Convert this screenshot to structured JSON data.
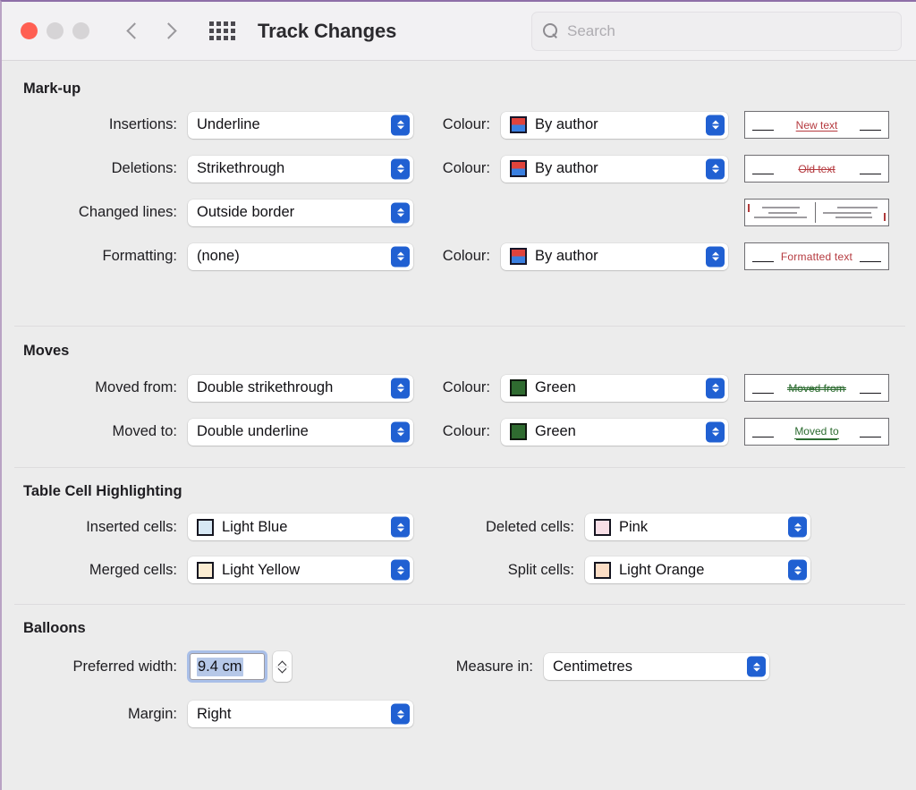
{
  "window": {
    "title": "Track Changes",
    "traffic_lights": [
      "close",
      "minimize",
      "zoom"
    ],
    "back_label": "Back",
    "forward_label": "Forward",
    "grid_label": "Show All"
  },
  "search": {
    "placeholder": "Search",
    "value": ""
  },
  "sections": {
    "markup": {
      "title": "Mark-up",
      "rows": [
        {
          "label": "Insertions:",
          "value": "Underline",
          "colour_label": "Colour:",
          "colour_value": "By author",
          "colour_swatch": "by-author",
          "preview_text": "New text",
          "preview_style": "insertion"
        },
        {
          "label": "Deletions:",
          "value": "Strikethrough",
          "colour_label": "Colour:",
          "colour_value": "By author",
          "colour_swatch": "by-author",
          "preview_text": "Old text",
          "preview_style": "deletion"
        },
        {
          "label": "Changed lines:",
          "value": "Outside border",
          "colour_label": "",
          "colour_value": "",
          "colour_swatch": "",
          "preview_text": "",
          "preview_style": "changed-lines"
        },
        {
          "label": "Formatting:",
          "value": "(none)",
          "colour_label": "Colour:",
          "colour_value": "By author",
          "colour_swatch": "by-author",
          "preview_text": "Formatted text",
          "preview_style": "formatting"
        }
      ]
    },
    "moves": {
      "title": "Moves",
      "rows": [
        {
          "label": "Moved from:",
          "value": "Double strikethrough",
          "colour_label": "Colour:",
          "colour_value": "Green",
          "colour_swatch": "green",
          "preview_text": "Moved from",
          "preview_style": "moved-from"
        },
        {
          "label": "Moved to:",
          "value": "Double underline",
          "colour_label": "Colour:",
          "colour_value": "Green",
          "colour_swatch": "green",
          "preview_text": "Moved to",
          "preview_style": "moved-to"
        }
      ]
    },
    "table_cells": {
      "title": "Table Cell Highlighting",
      "rows": [
        {
          "left_label": "Inserted cells:",
          "left_value": "Light Blue",
          "left_swatch": "light-blue",
          "right_label": "Deleted cells:",
          "right_value": "Pink",
          "right_swatch": "pink"
        },
        {
          "left_label": "Merged cells:",
          "left_value": "Light Yellow",
          "left_swatch": "light-yellow",
          "right_label": "Split cells:",
          "right_value": "Light Orange",
          "right_swatch": "light-orange"
        }
      ]
    },
    "balloons": {
      "title": "Balloons",
      "preferred_width_label": "Preferred width:",
      "preferred_width_value": "9.4 cm",
      "measure_in_label": "Measure in:",
      "measure_in_value": "Centimetres",
      "margin_label": "Margin:",
      "margin_value": "Right"
    }
  },
  "colors": {
    "accent": "#2060d2",
    "insertion_red": "#b53a3f",
    "move_green": "#2c6b30",
    "window_bg": "#ececec",
    "toolbar_bg": "#f2f1f3"
  }
}
